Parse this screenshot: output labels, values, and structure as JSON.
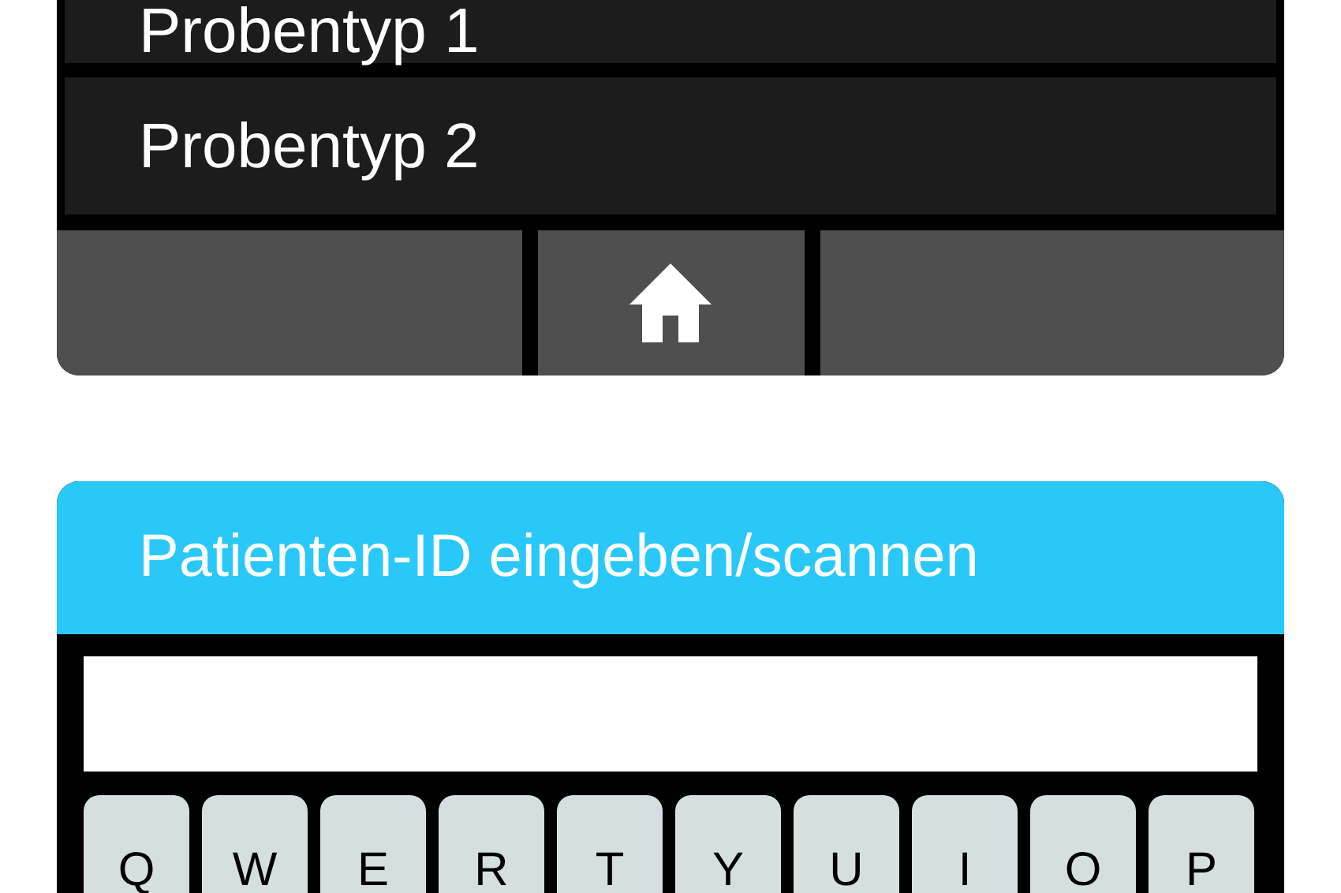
{
  "sample_types": [
    {
      "label": "Probentyp 1"
    },
    {
      "label": "Probentyp 2"
    }
  ],
  "nav_bar": [
    {
      "kind": "blank"
    },
    {
      "kind": "home"
    },
    {
      "kind": "blank"
    }
  ],
  "patient_dialog": {
    "title": "Patienten-ID eingeben/scannen",
    "keys": [
      "Q",
      "W",
      "E",
      "R",
      "T",
      "Y",
      "U",
      "I",
      "O",
      "P"
    ]
  }
}
